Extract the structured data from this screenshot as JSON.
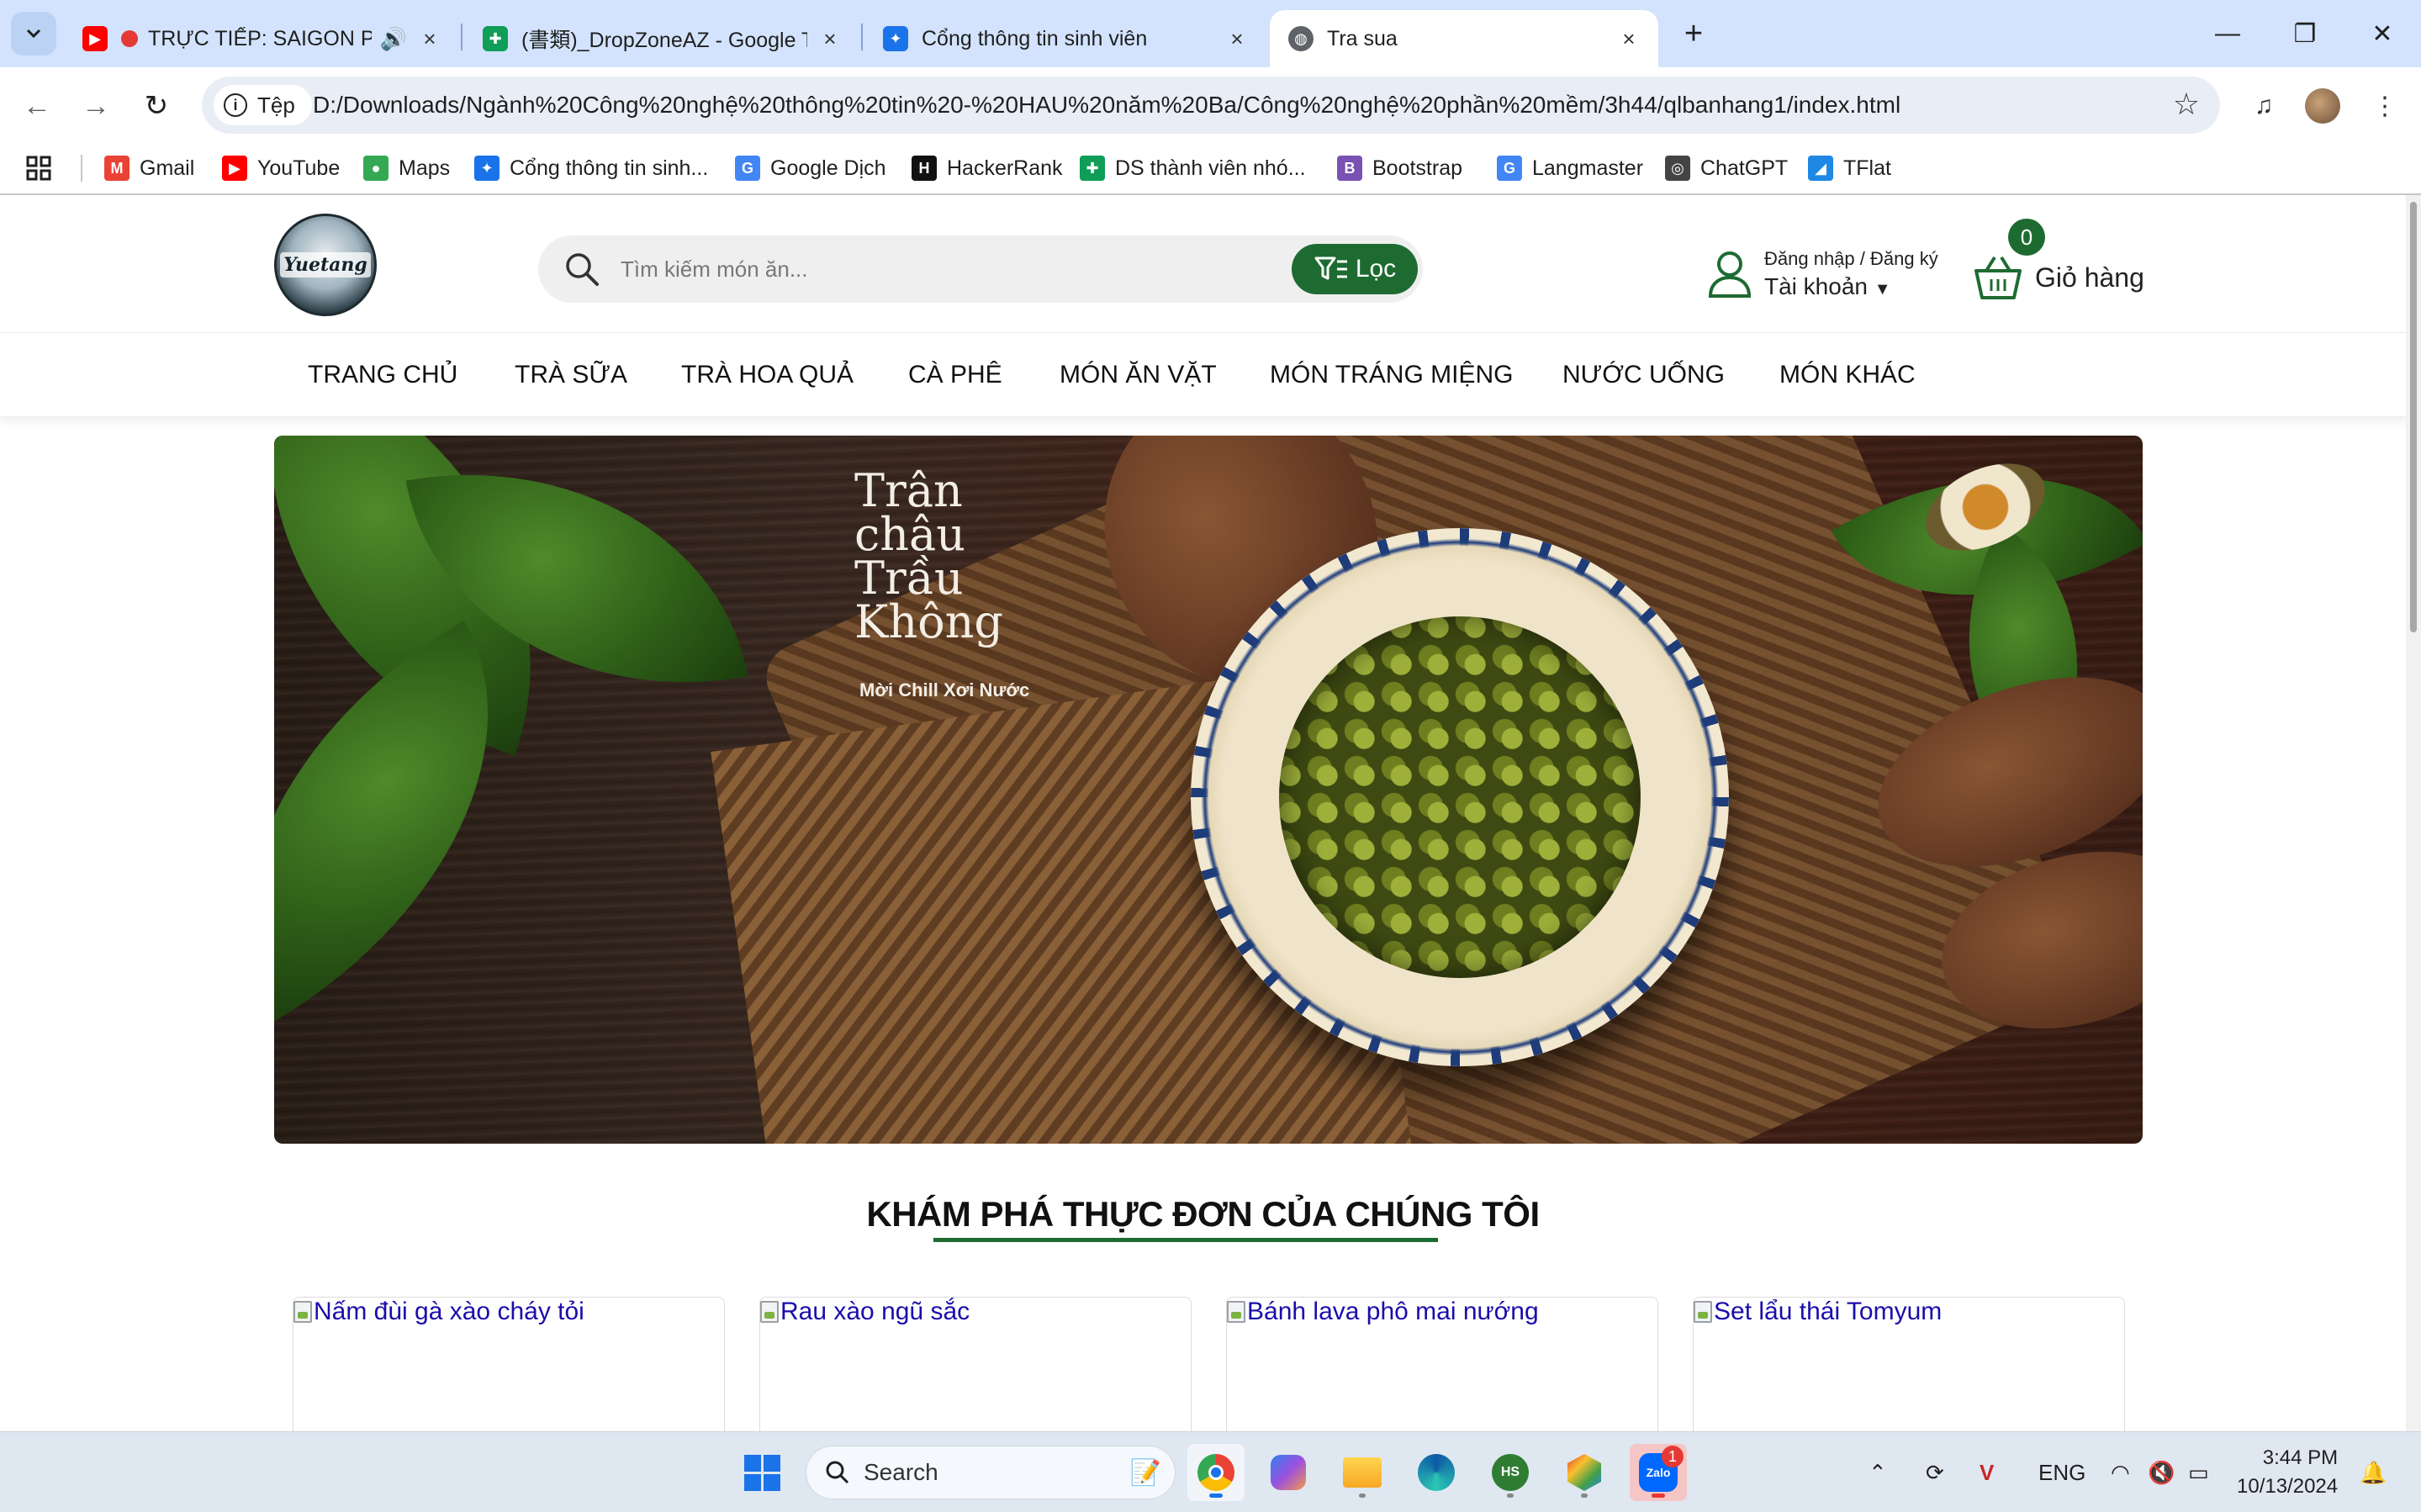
{
  "browser": {
    "tabs": [
      {
        "title": "TRỰC TIẾP: SAIGON PHAT",
        "icon": "youtube-icon",
        "audio": true
      },
      {
        "title": "(書類)_DropZoneAZ - Google Trang tính",
        "icon": "google-sheets-icon"
      },
      {
        "title": "Cổng thông tin sinh viên",
        "icon": "portal-icon"
      },
      {
        "title": "Tra sua",
        "icon": "globe-icon",
        "active": true
      }
    ],
    "address": {
      "chip_label": "Tệp",
      "url": "D:/Downloads/Ngành%20Công%20nghệ%20thông%20tin%20-%20HAU%20năm%20Ba/Công%20nghệ%20phần%20mềm/3h44/qlbanhang1/index.html"
    },
    "bookmarks": [
      {
        "label": "Gmail",
        "icon": "gmail-icon",
        "color": "#ea4335"
      },
      {
        "label": "YouTube",
        "icon": "youtube-icon",
        "color": "#ff0000"
      },
      {
        "label": "Maps",
        "icon": "maps-icon",
        "color": "#34a853"
      },
      {
        "label": "Cổng thông tin sinh...",
        "icon": "portal-icon",
        "color": "#1a73e8"
      },
      {
        "label": "Google Dịch",
        "icon": "google-translate-icon",
        "color": "#4285f4"
      },
      {
        "label": "HackerRank",
        "icon": "hackerrank-icon",
        "color": "#111111"
      },
      {
        "label": "DS thành viên nhó...",
        "icon": "google-sheets-icon",
        "color": "#0f9d58"
      },
      {
        "label": "Bootstrap",
        "icon": "bootstrap-icon",
        "color": "#7952b3"
      },
      {
        "label": "Langmaster",
        "icon": "google-icon",
        "color": "#4285f4"
      },
      {
        "label": "ChatGPT",
        "icon": "chatgpt-icon",
        "color": "#444444"
      },
      {
        "label": "TFlat",
        "icon": "tflat-icon",
        "color": "#1e88e5"
      }
    ]
  },
  "site": {
    "logo_text": "Yuetang",
    "search_placeholder": "Tìm kiếm món ăn...",
    "filter_label": "Lọc",
    "account": {
      "top": "Đăng nhập / Đăng ký",
      "bottom": "Tài khoản"
    },
    "cart": {
      "label": "Giỏ hàng",
      "count": "0"
    },
    "nav": [
      "TRANG CHỦ",
      "TRÀ SỮA",
      "TRÀ HOA QUẢ",
      "CÀ PHÊ",
      "MÓN ĂN VẶT",
      "MÓN TRÁNG MIỆNG",
      "NƯỚC UỐNG",
      "MÓN KHÁC"
    ],
    "banner": {
      "title": "Trân\nchâu\nTrầu\nKhông",
      "subtitle": "Mời Chill Xơi Nước"
    },
    "section_title": "KHÁM PHÁ THỰC ĐƠN CỦA CHÚNG TÔI",
    "products": [
      {
        "alt": "Nấm đùi gà xào cháy tỏi"
      },
      {
        "alt": "Rau xào ngũ sắc"
      },
      {
        "alt": "Bánh lava phô mai nướng"
      },
      {
        "alt": "Set lẩu thái Tomyum"
      }
    ],
    "brand_color": "#1e6b32"
  },
  "taskbar": {
    "search_label": "Search",
    "tray": {
      "language": "ENG",
      "time": "3:44 PM",
      "date": "10/13/2024",
      "zalo_badge": "1"
    }
  }
}
